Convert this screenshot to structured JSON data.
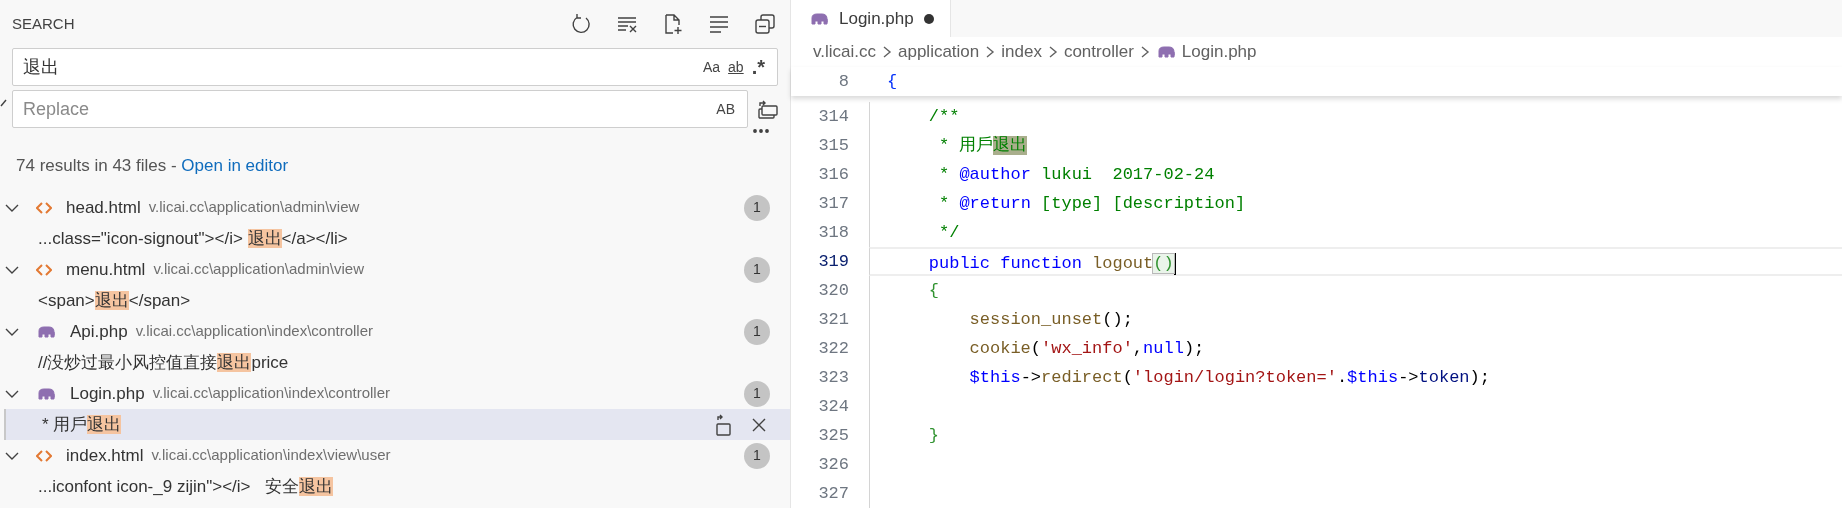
{
  "search_panel": {
    "title": "SEARCH",
    "search_field": {
      "value": "退出",
      "options": [
        {
          "label": "Aa",
          "kind": "case"
        },
        {
          "label": "ab",
          "kind": "word"
        },
        {
          "label": ".*",
          "kind": "regex"
        }
      ]
    },
    "replace_field": {
      "placeholder": "Replace",
      "preserve_case": "AB"
    },
    "summary": {
      "text": "74 results in 43 files - ",
      "link": "Open in editor"
    },
    "results": [
      {
        "file": "head.html",
        "path": "v.licai.cc\\application\\admin\\view",
        "kind": "html",
        "count": "1",
        "expanded": true,
        "matches": [
          {
            "before": "...class=\"icon-signout\"></i> ",
            "match": "退出",
            "after": "</a></li>",
            "selected": false
          }
        ]
      },
      {
        "file": "menu.html",
        "path": "v.licai.cc\\application\\admin\\view",
        "kind": "html",
        "count": "1",
        "expanded": true,
        "matches": [
          {
            "before": "<span>",
            "match": "退出",
            "after": "</span>",
            "selected": false
          }
        ]
      },
      {
        "file": "Api.php",
        "path": "v.licai.cc\\application\\index\\controller",
        "kind": "php",
        "count": "1",
        "expanded": true,
        "matches": [
          {
            "before": "//没炒过最小风控值直接",
            "match": "退出",
            "after": "price",
            "selected": false
          }
        ]
      },
      {
        "file": "Login.php",
        "path": "v.licai.cc\\application\\index\\controller",
        "kind": "php",
        "count": "1",
        "expanded": true,
        "matches": [
          {
            "before": "* 用戶",
            "match": "退出",
            "selected": true
          }
        ]
      },
      {
        "file": "index.html",
        "path": "v.licai.cc\\application\\index\\view\\user",
        "kind": "html",
        "count": "1",
        "expanded": true,
        "matches": [
          {
            "before": "...iconfont icon-_9 zijin\"></i>   安全",
            "match": "退出",
            "selected": false
          }
        ]
      }
    ]
  },
  "editor": {
    "tab": {
      "label": "Login.php",
      "dirty": true
    },
    "breadcrumbs": [
      {
        "label": "v.licai.cc",
        "kind": "folder"
      },
      {
        "label": "application",
        "kind": "folder"
      },
      {
        "label": "index",
        "kind": "folder"
      },
      {
        "label": "controller",
        "kind": "folder"
      },
      {
        "label": "Login.php",
        "kind": "php"
      }
    ],
    "sticky": {
      "number": "8",
      "tokens": [
        {
          "t": "{",
          "kind": "bracket"
        }
      ]
    },
    "lines": [
      {
        "number": "314",
        "current": false,
        "tokens": [
          {
            "t": "    /**",
            "kind": "comment"
          }
        ]
      },
      {
        "number": "315",
        "current": false,
        "tokens": [
          {
            "t": "     * 用戶",
            "kind": "comment"
          },
          {
            "t": "退出",
            "kind": "match"
          }
        ]
      },
      {
        "number": "316",
        "current": false,
        "tokens": [
          {
            "t": "     * ",
            "kind": "comment"
          },
          {
            "t": "@author",
            "kind": "keyword"
          },
          {
            "t": " lukui  2017-02-24",
            "kind": "comment"
          }
        ]
      },
      {
        "number": "317",
        "current": false,
        "tokens": [
          {
            "t": "     * ",
            "kind": "comment"
          },
          {
            "t": "@return",
            "kind": "keyword"
          },
          {
            "t": " [type] [description]",
            "kind": "comment"
          }
        ]
      },
      {
        "number": "318",
        "current": false,
        "tokens": [
          {
            "t": "     */",
            "kind": "comment"
          }
        ]
      },
      {
        "number": "319",
        "current": true,
        "tokens": [
          {
            "t": "    public",
            "kind": "keyword"
          },
          {
            "t": " function",
            "kind": "keyword"
          },
          {
            "t": " logout",
            "kind": "func"
          },
          {
            "t": "()",
            "kind": "pair"
          }
        ]
      },
      {
        "number": "320",
        "current": false,
        "tokens": [
          {
            "t": "    {",
            "kind": "brace"
          }
        ]
      },
      {
        "number": "321",
        "current": false,
        "tokens": [
          {
            "t": "        session_unset",
            "kind": "func"
          },
          {
            "t": "();",
            "kind": "plain"
          }
        ]
      },
      {
        "number": "322",
        "current": false,
        "tokens": [
          {
            "t": "        cookie",
            "kind": "func"
          },
          {
            "t": "(",
            "kind": "plain"
          },
          {
            "t": "'wx_info'",
            "kind": "string"
          },
          {
            "t": ",",
            "kind": "plain"
          },
          {
            "t": "null",
            "kind": "keyword"
          },
          {
            "t": ");",
            "kind": "plain"
          }
        ]
      },
      {
        "number": "323",
        "current": false,
        "tokens": [
          {
            "t": "        $this",
            "kind": "keyword"
          },
          {
            "t": "->",
            "kind": "plain"
          },
          {
            "t": "redirect",
            "kind": "func"
          },
          {
            "t": "(",
            "kind": "plain"
          },
          {
            "t": "'login/login?token='",
            "kind": "string"
          },
          {
            "t": ".",
            "kind": "plain"
          },
          {
            "t": "$this",
            "kind": "keyword"
          },
          {
            "t": "->",
            "kind": "plain"
          },
          {
            "t": "token",
            "kind": "prop"
          },
          {
            "t": ");",
            "kind": "plain"
          }
        ]
      },
      {
        "number": "324",
        "current": false
      },
      {
        "number": "325",
        "current": false,
        "tokens": [
          {
            "t": "    }",
            "kind": "brace"
          }
        ]
      },
      {
        "number": "326",
        "current": false
      },
      {
        "number": "327",
        "current": false
      }
    ]
  }
}
